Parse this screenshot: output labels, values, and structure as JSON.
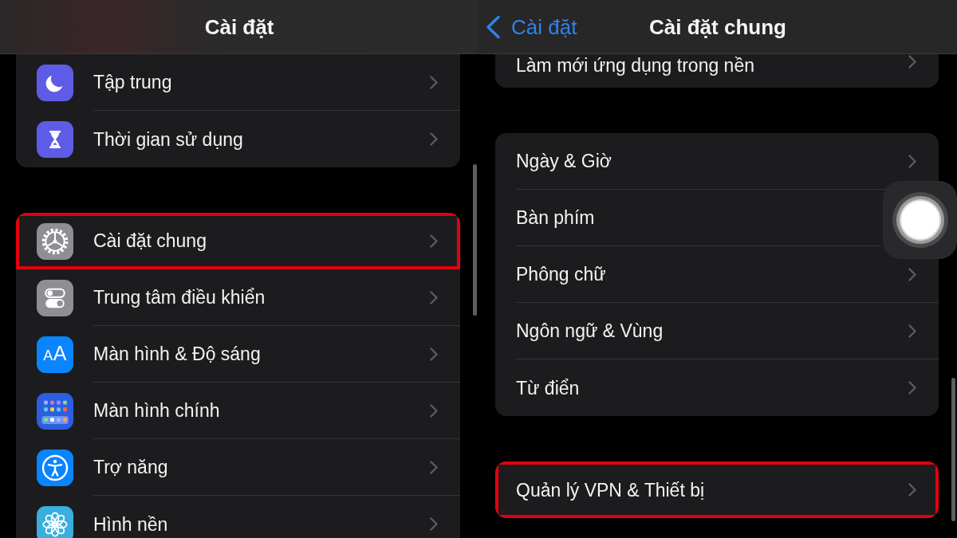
{
  "left_panel": {
    "title": "Cài đặt",
    "groups": [
      {
        "items": [
          {
            "label": "Tập trung",
            "kind": "focus",
            "color": "#5e5ce6",
            "highlighted": false,
            "chevron": true
          },
          {
            "label": "Thời gian sử dụng",
            "kind": "screentime",
            "color": "#5e5ce6",
            "highlighted": false,
            "chevron": true
          }
        ]
      },
      {
        "items": [
          {
            "label": "Cài đặt chung",
            "kind": "general",
            "color": "#8e8e93",
            "highlighted": true,
            "chevron": true
          },
          {
            "label": "Trung tâm điều khiển",
            "kind": "controls",
            "color": "#8e8e93",
            "highlighted": false,
            "chevron": true
          },
          {
            "label": "Màn hình & Độ sáng",
            "kind": "display",
            "color": "#0a84ff",
            "icon_text": "AA",
            "highlighted": false,
            "chevron": true
          },
          {
            "label": "Màn hình chính",
            "kind": "homescreen",
            "color": "#2c5fe0",
            "highlighted": false,
            "chevron": true
          },
          {
            "label": "Trợ năng",
            "kind": "accessibility",
            "color": "#0a84ff",
            "highlighted": false,
            "chevron": true
          },
          {
            "label": "Hình nền",
            "kind": "wallpaper",
            "color": "#3aaedc",
            "highlighted": false,
            "chevron": true
          }
        ]
      }
    ]
  },
  "right_panel": {
    "back_button": {
      "label": "Cài đặt"
    },
    "title": "Cài đặt chung",
    "groups": [
      {
        "items": [
          {
            "label": "Làm mới ứng dụng trong nền",
            "highlighted": false,
            "chevron": true
          }
        ]
      },
      {
        "items": [
          {
            "label": "Ngày & Giờ",
            "highlighted": false,
            "chevron": true
          },
          {
            "label": "Bàn phím",
            "highlighted": false,
            "chevron": false
          },
          {
            "label": "Phông chữ",
            "highlighted": false,
            "chevron": true
          },
          {
            "label": "Ngôn ngữ & Vùng",
            "highlighted": false,
            "chevron": true
          },
          {
            "label": "Từ điển",
            "highlighted": false,
            "chevron": true
          }
        ]
      },
      {
        "items": [
          {
            "label": "Quản lý VPN & Thiết bị",
            "highlighted": true,
            "chevron": true
          }
        ]
      }
    ]
  }
}
